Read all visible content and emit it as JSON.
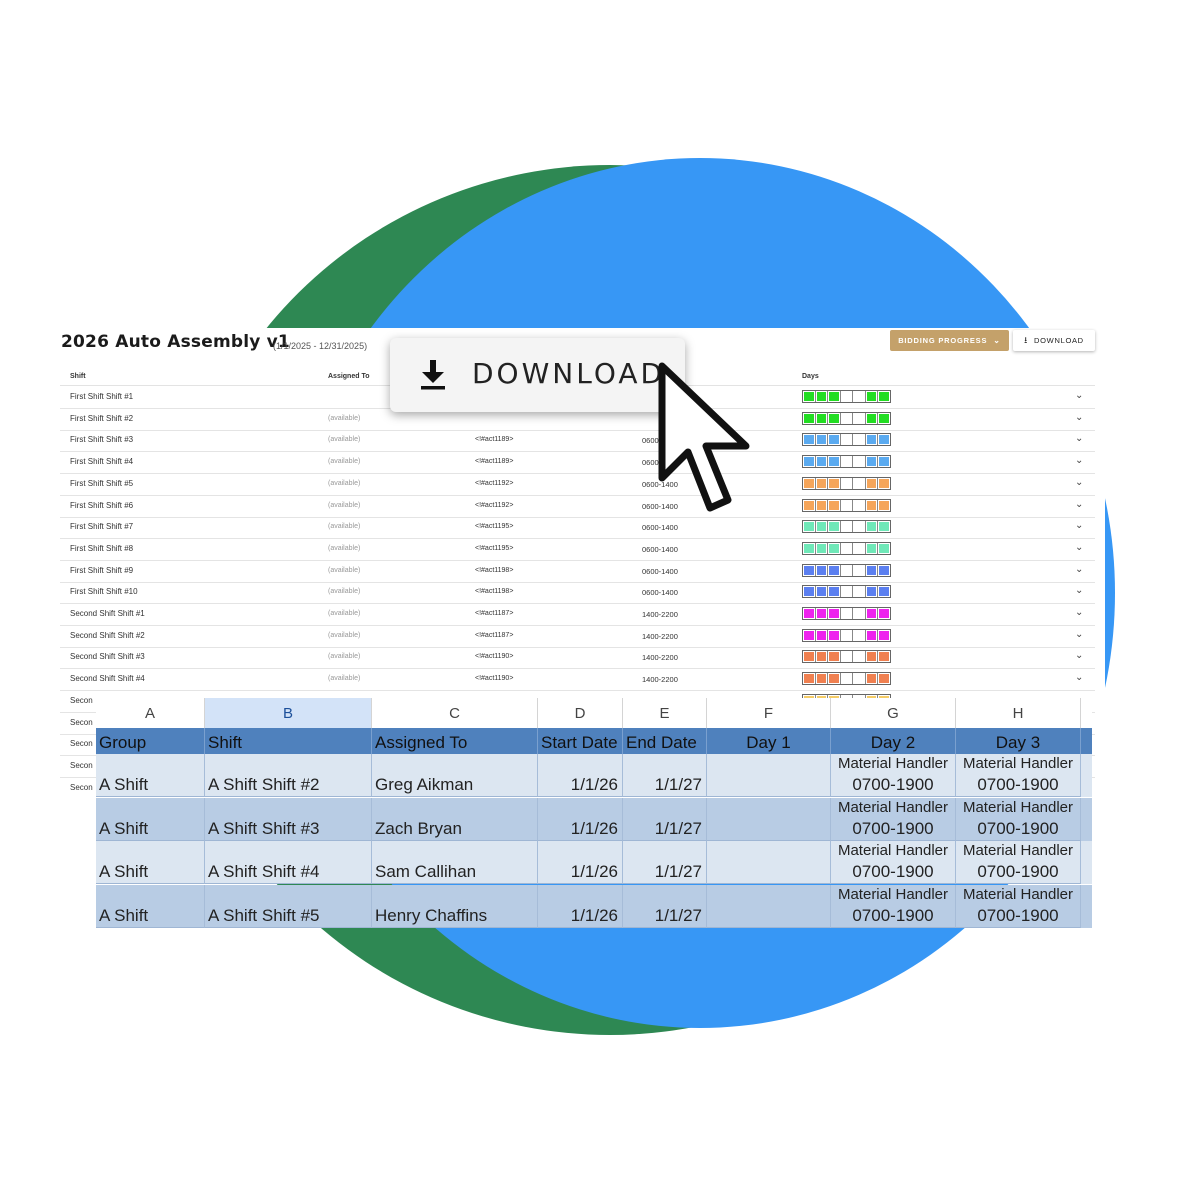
{
  "app": {
    "title": "2026 Auto Assembly v1",
    "date_range": "(1/1/2025 - 12/31/2025)",
    "bidding_button": "BIDDING PROGRESS",
    "download_button": "DOWNLOAD",
    "columns": {
      "shift": "Shift",
      "assigned": "Assigned To",
      "days": "Days"
    },
    "rows": [
      {
        "shift": "First Shift Shift #1",
        "assigned": "",
        "act": "",
        "time": "",
        "color": "#22dd22",
        "days": [
          1,
          1,
          1,
          0,
          0,
          1,
          1
        ]
      },
      {
        "shift": "First Shift Shift #2",
        "assigned": "(available)",
        "act": "",
        "time": "",
        "color": "#22dd22",
        "days": [
          1,
          1,
          1,
          0,
          0,
          1,
          1
        ]
      },
      {
        "shift": "First Shift Shift #3",
        "assigned": "(available)",
        "act": "<!#act1189>",
        "time": "0600",
        "color": "#5aaaf0",
        "days": [
          1,
          1,
          1,
          0,
          0,
          1,
          1
        ]
      },
      {
        "shift": "First Shift Shift #4",
        "assigned": "(available)",
        "act": "<!#act1189>",
        "time": "0600",
        "color": "#5aaaf0",
        "days": [
          1,
          1,
          1,
          0,
          0,
          1,
          1
        ]
      },
      {
        "shift": "First Shift Shift #5",
        "assigned": "(available)",
        "act": "<!#act1192>",
        "time": "0600-1400",
        "color": "#f5a55a",
        "days": [
          1,
          1,
          1,
          0,
          0,
          1,
          1
        ]
      },
      {
        "shift": "First Shift Shift #6",
        "assigned": "(available)",
        "act": "<!#act1192>",
        "time": "0600-1400",
        "color": "#f5a55a",
        "days": [
          1,
          1,
          1,
          0,
          0,
          1,
          1
        ]
      },
      {
        "shift": "First Shift Shift #7",
        "assigned": "(available)",
        "act": "<!#act1195>",
        "time": "0600-1400",
        "color": "#6fe8b8",
        "days": [
          1,
          1,
          1,
          0,
          0,
          1,
          1
        ]
      },
      {
        "shift": "First Shift Shift #8",
        "assigned": "(available)",
        "act": "<!#act1195>",
        "time": "0600-1400",
        "color": "#6fe8b8",
        "days": [
          1,
          1,
          1,
          0,
          0,
          1,
          1
        ]
      },
      {
        "shift": "First Shift Shift #9",
        "assigned": "(available)",
        "act": "<!#act1198>",
        "time": "0600-1400",
        "color": "#5b7ff0",
        "days": [
          1,
          1,
          1,
          0,
          0,
          1,
          1
        ]
      },
      {
        "shift": "First Shift Shift #10",
        "assigned": "(available)",
        "act": "<!#act1198>",
        "time": "0600-1400",
        "color": "#5b7ff0",
        "days": [
          1,
          1,
          1,
          0,
          0,
          1,
          1
        ]
      },
      {
        "shift": "Second Shift Shift #1",
        "assigned": "(available)",
        "act": "<!#act1187>",
        "time": "1400-2200",
        "color": "#ee22ee",
        "days": [
          1,
          1,
          1,
          0,
          0,
          1,
          1
        ]
      },
      {
        "shift": "Second Shift Shift #2",
        "assigned": "(available)",
        "act": "<!#act1187>",
        "time": "1400-2200",
        "color": "#ee22ee",
        "days": [
          1,
          1,
          1,
          0,
          0,
          1,
          1
        ]
      },
      {
        "shift": "Second Shift Shift #3",
        "assigned": "(available)",
        "act": "<!#act1190>",
        "time": "1400-2200",
        "color": "#f08050",
        "days": [
          1,
          1,
          1,
          0,
          0,
          1,
          1
        ]
      },
      {
        "shift": "Second Shift Shift #4",
        "assigned": "(available)",
        "act": "<!#act1190>",
        "time": "1400-2200",
        "color": "#f08050",
        "days": [
          1,
          1,
          1,
          0,
          0,
          1,
          1
        ]
      },
      {
        "shift": "Secon",
        "assigned": "",
        "act": "",
        "time": "",
        "color": "#f5cc66",
        "days": [
          1,
          1,
          1,
          0,
          0,
          1,
          1
        ]
      },
      {
        "shift": "Secon",
        "assigned": "",
        "act": "",
        "time": "",
        "color": "",
        "days": []
      },
      {
        "shift": "Secon",
        "assigned": "",
        "act": "",
        "time": "",
        "color": "",
        "days": []
      },
      {
        "shift": "Secon",
        "assigned": "",
        "act": "",
        "time": "",
        "color": "",
        "days": []
      },
      {
        "shift": "Secon",
        "assigned": "",
        "act": "",
        "time": "",
        "color": "",
        "days": []
      }
    ]
  },
  "popup": {
    "label": "DOWNLOAD",
    "icon": "download-icon"
  },
  "cursor": {
    "icon": "mouse-pointer-icon"
  },
  "sheet": {
    "column_letters": [
      "A",
      "B",
      "C",
      "D",
      "E",
      "F",
      "G",
      "H"
    ],
    "selected_column": "B",
    "headers": [
      "Group",
      "Shift",
      "Assigned To",
      "Start Date",
      "End Date",
      "Day 1",
      "Day 2",
      "Day 3"
    ],
    "rows": [
      {
        "group": "A Shift",
        "shift": "A Shift Shift #2",
        "assigned": "Greg Aikman",
        "start": "1/1/26",
        "end": "1/1/27",
        "day1": "",
        "day2_role": "Material Handler",
        "day2_time": "0700-1900",
        "day3_role": "Material Handler",
        "day3_time": "0700-1900"
      },
      {
        "group": "A Shift",
        "shift": "A Shift Shift #3",
        "assigned": "Zach Bryan",
        "start": "1/1/26",
        "end": "1/1/27",
        "day1": "",
        "day2_role": "Material Handler",
        "day2_time": "0700-1900",
        "day3_role": "Material Handler",
        "day3_time": "0700-1900"
      },
      {
        "group": "A Shift",
        "shift": "A Shift Shift #4",
        "assigned": "Sam Callihan",
        "start": "1/1/26",
        "end": "1/1/27",
        "day1": "",
        "day2_role": "Material Handler",
        "day2_time": "0700-1900",
        "day3_role": "Material Handler",
        "day3_time": "0700-1900"
      },
      {
        "group": "A Shift",
        "shift": "A Shift Shift #5",
        "assigned": "Henry Chaffins",
        "start": "1/1/26",
        "end": "1/1/27",
        "day1": "",
        "day2_role": "Material Handler",
        "day2_time": "0700-1900",
        "day3_role": "Material Handler",
        "day3_time": "0700-1900"
      }
    ]
  },
  "colors": {
    "blob_green": "#2e8853",
    "blob_blue": "#3797f5",
    "bidding_gold": "#c4a16a",
    "sheet_header_blue": "#4f81bd"
  }
}
